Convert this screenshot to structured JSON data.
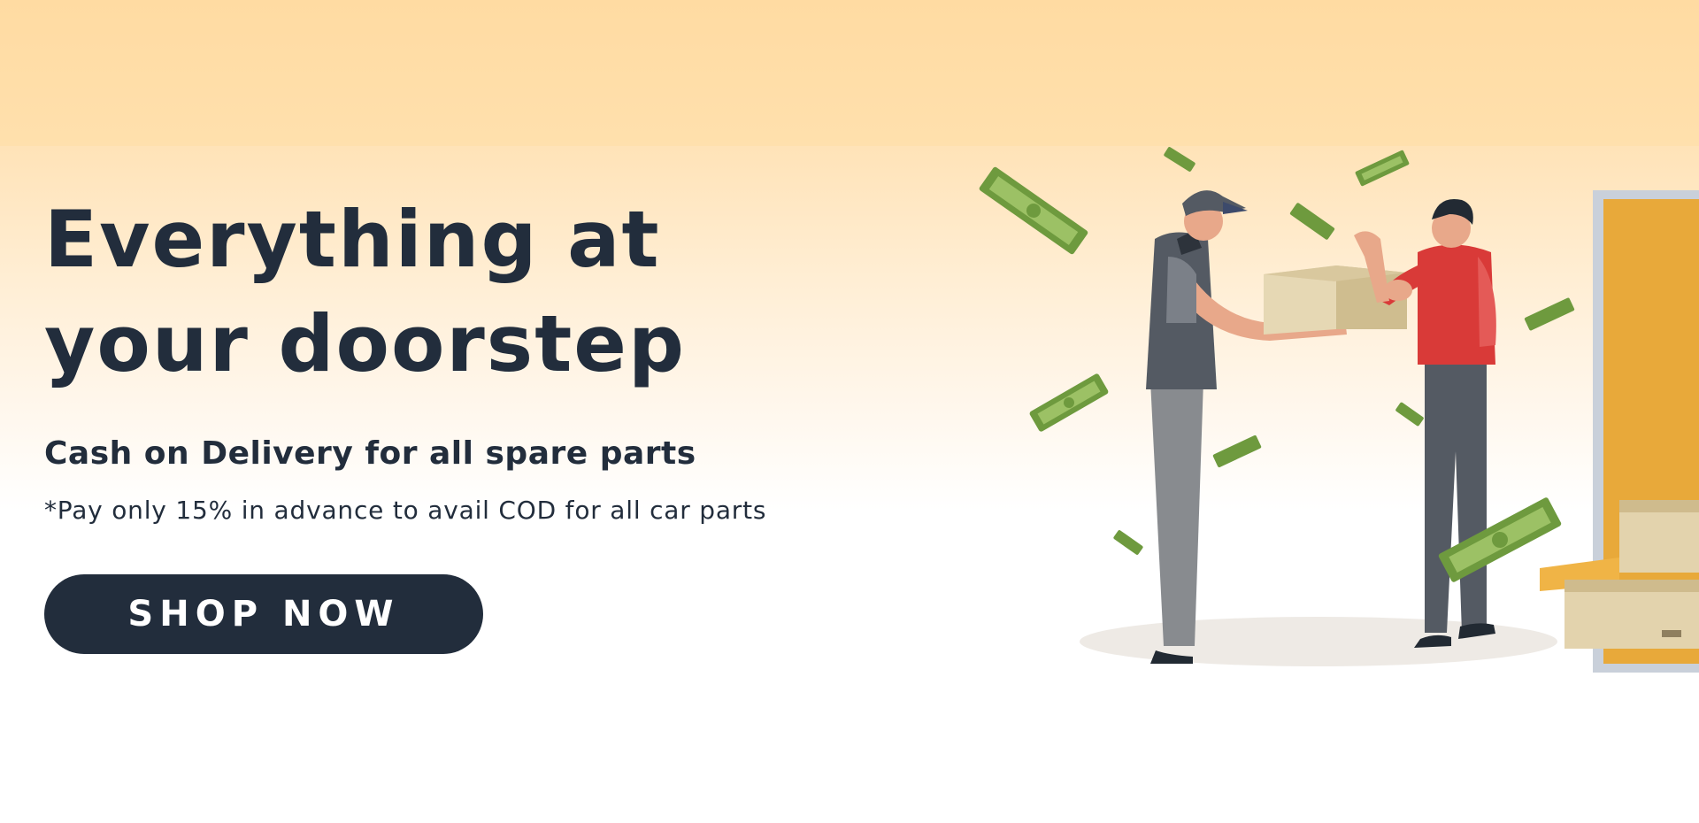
{
  "banner": {
    "headline_line1": "Everything at",
    "headline_line2": "your doorstep",
    "subheading": "Cash on Delivery for all spare parts",
    "note": "*Pay only 15% in advance to avail COD for all car parts",
    "cta_label": "SHOP NOW"
  },
  "illustration": {
    "scene": "delivery-handover",
    "icons": [
      "delivery-person-icon",
      "customer-icon",
      "parcel-box-icon",
      "cash-note-icon",
      "door-icon",
      "stacked-boxes-icon"
    ]
  },
  "colors": {
    "text_dark": "#222d3c",
    "button_bg": "#222d3c",
    "button_text": "#ffffff",
    "banner_top": "#ffdca4",
    "banner_bottom": "#ffffff",
    "cash_green": "#6e9a3e",
    "shirt_red": "#d93a38",
    "door_orange": "#e8a93a",
    "box_tan": "#d8c7a0"
  }
}
